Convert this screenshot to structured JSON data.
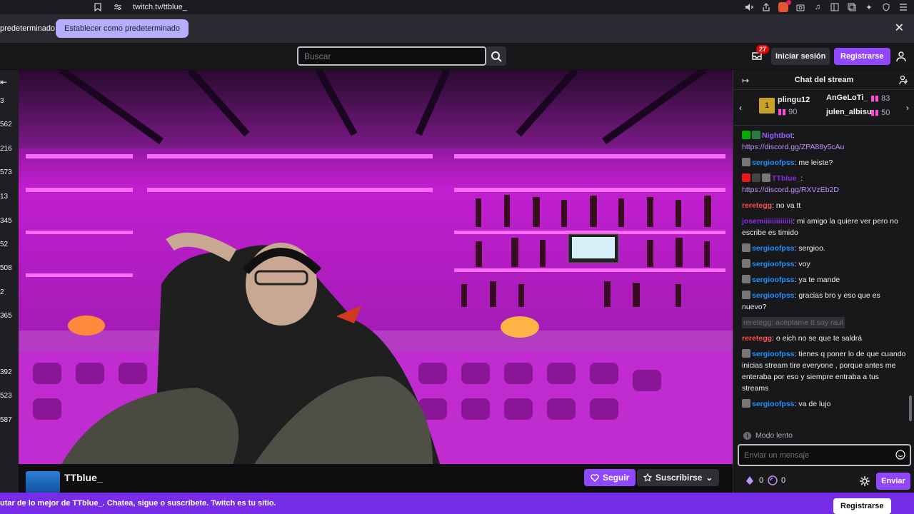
{
  "browser": {
    "url": "twitch.tv/ttblue_"
  },
  "notice": {
    "text": "predeterminado",
    "button": "Establecer como predeterminado"
  },
  "topnav": {
    "search_placeholder": "Buscar",
    "notification_count": "27",
    "login": "Iniciar sesión",
    "register": "Registrarse"
  },
  "rail": {
    "numbers": [
      "3",
      "562",
      "216",
      "573",
      "13",
      "345",
      "52",
      "508",
      "2",
      "365",
      "392",
      "523",
      "587"
    ]
  },
  "channel": {
    "name": "TTblue_",
    "follow": "Seguir",
    "subscribe": "Suscribirse"
  },
  "chat": {
    "title": "Chat del stream",
    "leaderboard": [
      {
        "name": "plingu12",
        "score": "90"
      },
      {
        "name": "AnGeLoTi_",
        "score": "83"
      },
      {
        "name": "julen_albisu",
        "score": "50"
      }
    ],
    "messages": [
      {
        "user": "Nightbot",
        "text": "",
        "link": "https://discord.gg/ZPA88y5cAu"
      },
      {
        "user": "sergioofpss",
        "text": ": me leiste?"
      },
      {
        "user": "TTblue_",
        "text": "",
        "link": "https://discord.gg/RXVzEb2D"
      },
      {
        "user": "reretegg",
        "text": ": no va tt"
      },
      {
        "user": "josemiiiiiiiiiiiiii",
        "text": ": mi amigo la quiere ver pero no escribe es timido"
      },
      {
        "user": "sergioofpss",
        "text": ": sergioo."
      },
      {
        "user": "sergioofpss",
        "text": ": voy"
      },
      {
        "user": "sergioofpss",
        "text": ": ya te mande"
      },
      {
        "user": "sergioofpss",
        "text": ": gracias bro y eso que es nuevo?"
      },
      {
        "user": "reretegg",
        "text": ": acéptame tt soy raul"
      },
      {
        "user": "reretegg",
        "text": ": o eich no se que te saldrá"
      },
      {
        "user": "sergioofpss",
        "text": ": tienes q poner lo de que cuando inicias stream tire everyone , porque antes me enteraba por eso y siempre entraba a tus streams"
      },
      {
        "user": "sergioofpss",
        "text": ": va de lujo"
      }
    ],
    "slow_mode": "Modo lento",
    "input_placeholder": "Enviar un mensaje",
    "points_a": "0",
    "points_b": "0",
    "send": "Enviar"
  },
  "banner": {
    "text": "utar de lo mejor de TTblue_. Chatea, sigue o suscríbete. Twitch es tu sitio.",
    "button": "Registrarse"
  },
  "colors": {
    "twitch_purple": "#9147ff",
    "banner_purple": "#772ce8",
    "bar_glow": "#ff3cff"
  }
}
